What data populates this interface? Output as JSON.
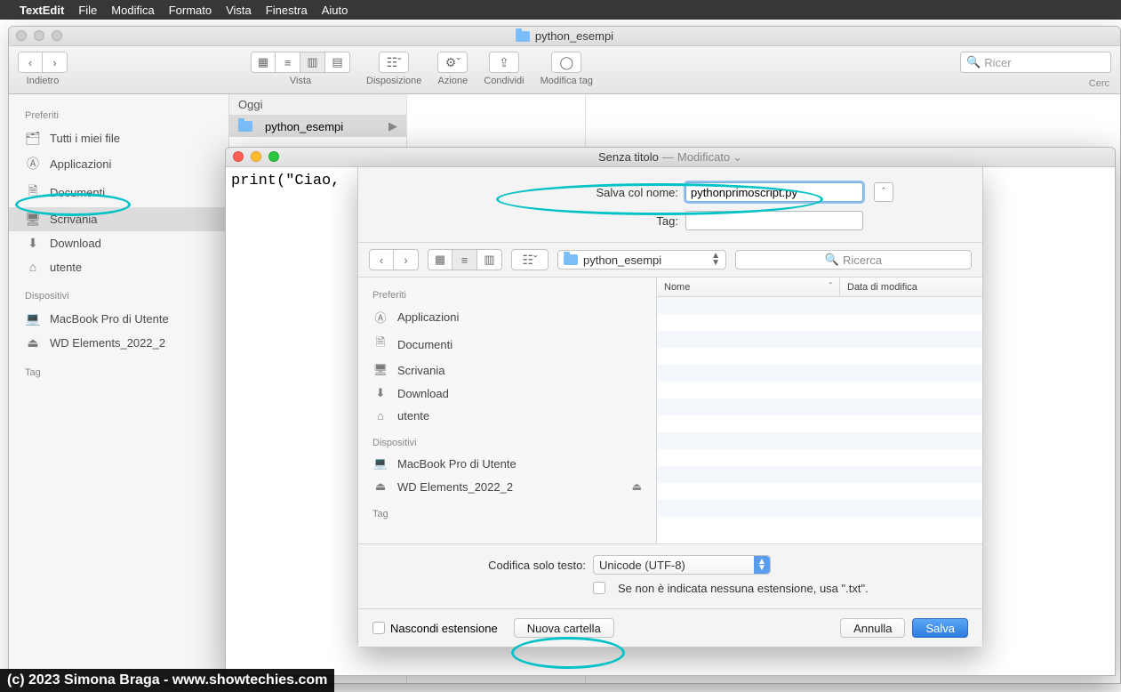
{
  "menubar": {
    "app": "TextEdit",
    "items": [
      "File",
      "Modifica",
      "Formato",
      "Vista",
      "Finestra",
      "Aiuto"
    ]
  },
  "finder": {
    "title": "python_esempi",
    "toolbar": {
      "back_label": "Indietro",
      "view_label": "Vista",
      "arrange_label": "Disposizione",
      "action_label": "Azione",
      "share_label": "Condividi",
      "edit_tags_label": "Modifica tag",
      "search_placeholder": "Ricer",
      "search_sub": "Cerc"
    },
    "sidebar": {
      "favorites_head": "Preferiti",
      "favorites": [
        {
          "icon": "all-files-icon",
          "label": "Tutti i miei file"
        },
        {
          "icon": "apps-icon",
          "label": "Applicazioni"
        },
        {
          "icon": "documents-icon",
          "label": "Documenti"
        },
        {
          "icon": "desktop-icon",
          "label": "Scrivania"
        },
        {
          "icon": "downloads-icon",
          "label": "Download"
        },
        {
          "icon": "home-icon",
          "label": "utente"
        }
      ],
      "devices_head": "Dispositivi",
      "devices": [
        {
          "icon": "laptop-icon",
          "label": "MacBook Pro di Utente"
        },
        {
          "icon": "external-disk-icon",
          "label": "WD Elements_2022_2"
        }
      ],
      "tags_head": "Tag"
    },
    "column": {
      "head": "Oggi",
      "row": "python_esempi"
    }
  },
  "textedit": {
    "title": "Senza titolo",
    "title_suffix": "Modificato",
    "doc_text": "print(\"Ciao, "
  },
  "save": {
    "name_label": "Salva col nome:",
    "name_value": "pythonprimoscript.py",
    "tag_label": "Tag:",
    "path": "python_esempi",
    "search_placeholder": "Ricerca",
    "sidebar": {
      "fav_head": "Preferiti",
      "fav": [
        {
          "icon": "apps-icon",
          "label": "Applicazioni"
        },
        {
          "icon": "documents-icon",
          "label": "Documenti"
        },
        {
          "icon": "desktop-icon",
          "label": "Scrivania"
        },
        {
          "icon": "downloads-icon",
          "label": "Download"
        },
        {
          "icon": "home-icon",
          "label": "utente"
        }
      ],
      "dev_head": "Dispositivi",
      "dev": [
        {
          "icon": "laptop-icon",
          "label": "MacBook Pro di Utente"
        },
        {
          "icon": "external-disk-icon",
          "label": "WD Elements_2022_2"
        }
      ],
      "tag_head": "Tag"
    },
    "columns": {
      "name": "Nome",
      "mod": "Data di modifica"
    },
    "encoding_label": "Codifica solo testo:",
    "encoding_value": "Unicode (UTF-8)",
    "extension_note": "Se non è indicata nessuna estensione, usa \".txt\".",
    "hide_ext": "Nascondi estensione",
    "new_folder": "Nuova cartella",
    "cancel": "Annulla",
    "ok": "Salva"
  },
  "watermark": "(c) 2023 Simona Braga - www.showtechies.com"
}
